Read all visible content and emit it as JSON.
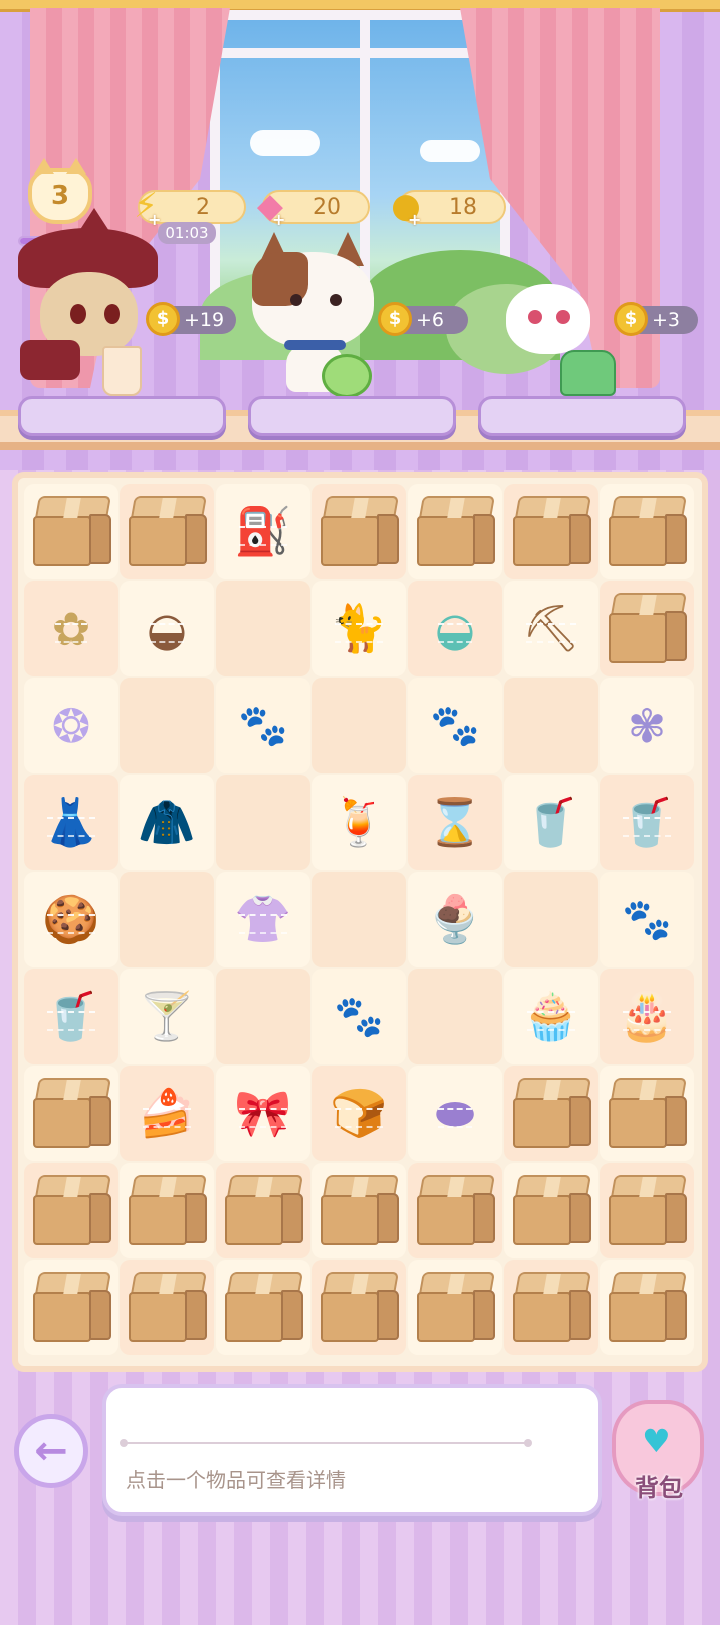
{
  "header": {
    "level": "3",
    "level_progress": 0.55,
    "energy": {
      "value": "2",
      "timer": "01:03"
    },
    "gems": {
      "value": "20"
    },
    "coins": {
      "value": "18"
    }
  },
  "orders": [
    {
      "reward": "+19"
    },
    {
      "reward": "+6"
    },
    {
      "reward": "+3"
    }
  ],
  "board": {
    "rows": [
      [
        "box",
        "box",
        "watering-can",
        "box",
        "box",
        "box",
        "box"
      ],
      [
        "tulip",
        "bowl",
        "empty",
        "cat-figure",
        "pet-bowl",
        "shovel",
        "box"
      ],
      [
        "pearl-shell",
        "empty",
        "paw",
        "empty",
        "paw",
        "empty",
        "hydrangea"
      ],
      [
        "yellow-dress",
        "pink-coat",
        "empty",
        "lemon-drink",
        "hourglass",
        "iced-tea",
        "iced-coffee"
      ],
      [
        "cat-cookie",
        "empty",
        "clothes-rack",
        "empty",
        "strawberry-parfait",
        "empty",
        "paw"
      ],
      [
        "iced-coffee",
        "glass-bow",
        "empty",
        "paw",
        "empty",
        "cream-puff",
        "fruit-cake"
      ],
      [
        "box",
        "strawberry-cake",
        "ribbon",
        "bread",
        "purple-jelly",
        "box",
        "box"
      ],
      [
        "box",
        "box",
        "box",
        "box",
        "box",
        "box",
        "box"
      ],
      [
        "box",
        "box",
        "box",
        "box",
        "box",
        "box",
        "box"
      ]
    ]
  },
  "bottom": {
    "hint": "点击一个物品可查看详情",
    "bag_label": "背包"
  }
}
